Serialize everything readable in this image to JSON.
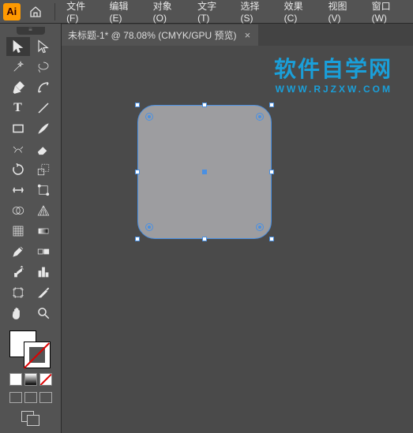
{
  "menubar": {
    "items": [
      {
        "label": "文件(F)"
      },
      {
        "label": "编辑(E)"
      },
      {
        "label": "对象(O)"
      },
      {
        "label": "文字(T)"
      },
      {
        "label": "选择(S)"
      },
      {
        "label": "效果(C)"
      },
      {
        "label": "视图(V)"
      },
      {
        "label": "窗口(W)"
      }
    ],
    "logo": "Ai"
  },
  "tab": {
    "title": "未标题-1* @ 78.08% (CMYK/GPU 预览)",
    "close": "×"
  },
  "watermark": {
    "main": "软件自学网",
    "sub": "WWW.RJZXW.COM"
  },
  "tools": {
    "text_glyph": "T"
  },
  "chart_data": null
}
